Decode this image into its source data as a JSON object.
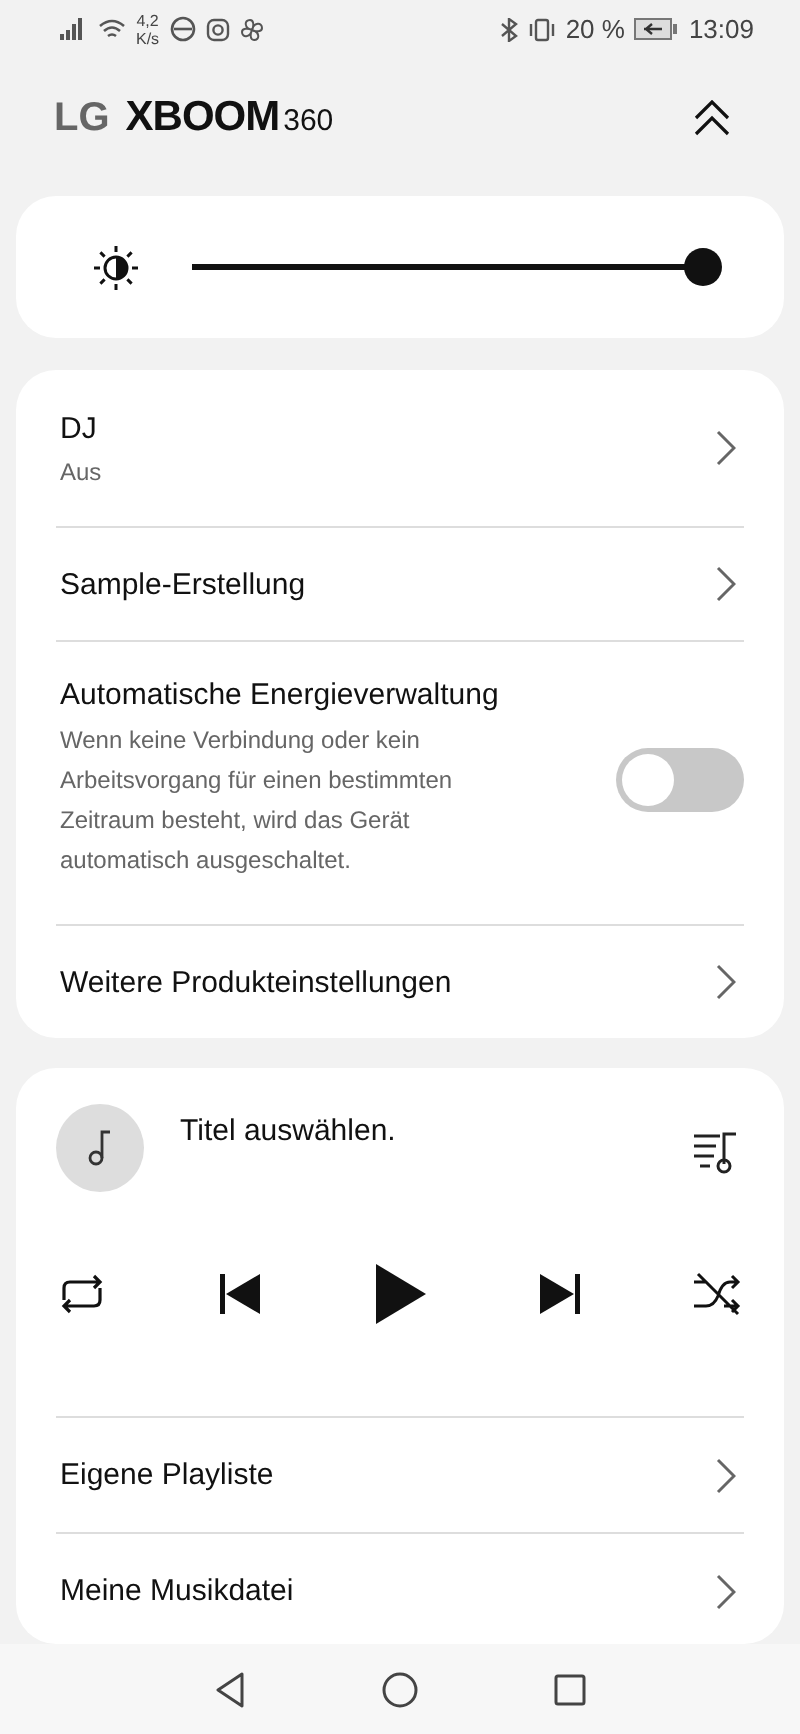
{
  "status_bar": {
    "speed": "4,2",
    "speed_unit": "K/s",
    "battery": "20 %",
    "time": "13:09"
  },
  "brand": {
    "logo": "LG",
    "name": "XBOOM",
    "model": "360"
  },
  "brightness": {
    "level": 1.0
  },
  "settings": [
    {
      "kind": "link",
      "title": "DJ",
      "subtitle": "Aus"
    },
    {
      "kind": "link",
      "title": "Sample-Erstellung"
    },
    {
      "kind": "toggle",
      "title": "Automatische Energieverwaltung",
      "description": "Wenn keine Verbindung oder kein Arbeitsvorgang für einen bestimmten Zeitraum besteht, wird das Gerät automatisch ausgeschaltet.",
      "on": false
    },
    {
      "kind": "link",
      "title": "Weitere Produkteinstellungen"
    }
  ],
  "player": {
    "track": "Titel auswählen."
  },
  "links": [
    "Eigene Playliste",
    "Meine Musikdatei"
  ]
}
